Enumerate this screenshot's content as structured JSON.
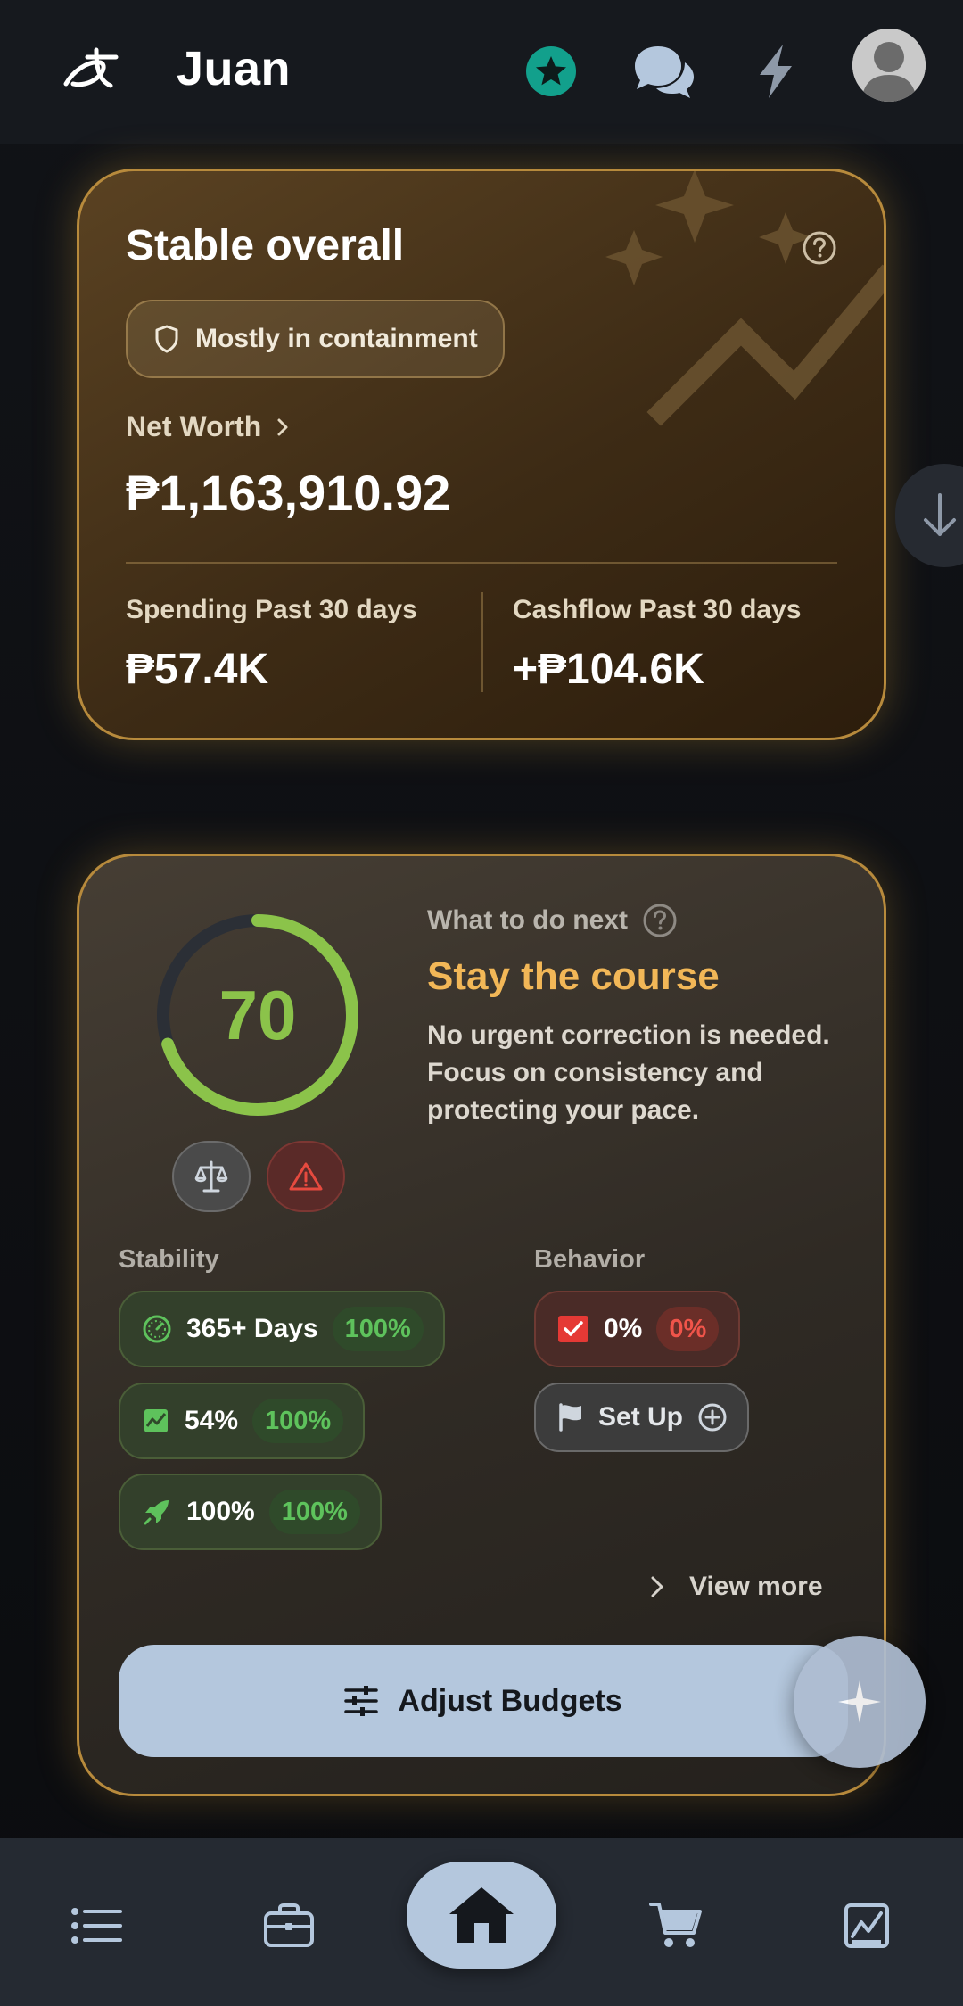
{
  "header": {
    "user_name": "Juan",
    "icons": [
      "logo-icon",
      "star-badge-icon",
      "chat-icon",
      "bolt-icon",
      "avatar"
    ]
  },
  "summary": {
    "status_title": "Stable overall",
    "containment_label": "Mostly in containment",
    "net_worth_label": "Net Worth",
    "net_worth_value": "₱1,163,910.92",
    "spending_label": "Spending Past 30 days",
    "spending_value": "₱57.4K",
    "cashflow_label": "Cashflow Past 30 days",
    "cashflow_value": "+₱104.6K"
  },
  "health": {
    "score": "70",
    "score_fraction": 0.7,
    "next_label": "What to do next",
    "next_title": "Stay the course",
    "next_description": "No urgent correction is needed. Focus on consistency and protecting your pace.",
    "stability_label": "Stability",
    "behavior_label": "Behavior",
    "stability_chips": [
      {
        "text": "365+ Days",
        "pct": "100%",
        "icon": "speedometer-icon"
      },
      {
        "text": "54%",
        "pct": "100%",
        "icon": "trend-chart-icon"
      },
      {
        "text": "100%",
        "pct": "100%",
        "icon": "rocket-icon"
      }
    ],
    "behavior_chips": [
      {
        "text": "0%",
        "pct": "0%",
        "icon": "checkbox-icon"
      },
      {
        "text": "Set Up",
        "icon": "flag-icon"
      }
    ],
    "view_more": "View more",
    "adjust_button": "Adjust Budgets"
  },
  "colors": {
    "accent_gold": "#b78a3c",
    "score_green": "#8bc34a",
    "next_title": "#f2b757",
    "button_bg": "#b4c7dd"
  },
  "nav": {
    "items": [
      "list-icon",
      "briefcase-icon",
      "home-icon",
      "cart-icon",
      "chart-icon"
    ],
    "active": "home-icon"
  }
}
